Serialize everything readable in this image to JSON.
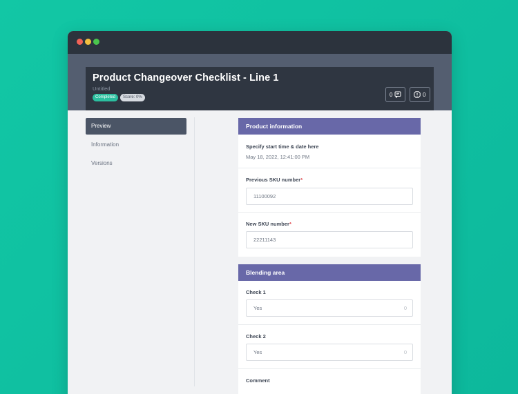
{
  "header": {
    "title": "Product Changeover Checklist - Line 1",
    "subtitle": "Untitled",
    "status_badge": "Completed",
    "score_badge": "Score: 0%",
    "comments_count": "0",
    "issues_count": "0"
  },
  "sidebar": {
    "items": [
      {
        "label": "Preview"
      },
      {
        "label": "Information"
      },
      {
        "label": "Versions"
      }
    ]
  },
  "sections": [
    {
      "title": "Product information",
      "fields": [
        {
          "label": "Specify start time & date here",
          "value": "May 18, 2022, 12:41:00 PM"
        },
        {
          "label": "Previous SKU number",
          "required_mark": "*",
          "value": "11100092"
        },
        {
          "label": "New SKU number",
          "required_mark": "*",
          "value": "22211143"
        }
      ]
    },
    {
      "title": "Blending area",
      "fields": [
        {
          "label": "Check 1",
          "value": "Yes",
          "count": "0"
        },
        {
          "label": "Check 2",
          "value": "Yes",
          "count": "0"
        },
        {
          "label": "Comment"
        }
      ]
    }
  ],
  "colors": {
    "background": "#12c7a5",
    "window_titlebar": "#2c333d",
    "header": "#2f3641",
    "section_header": "#6868a8",
    "completed_badge": "#2bbf9f",
    "active_nav": "#4b5566"
  },
  "icons": {
    "comments": "comment-icon",
    "issues": "alert-icon"
  }
}
